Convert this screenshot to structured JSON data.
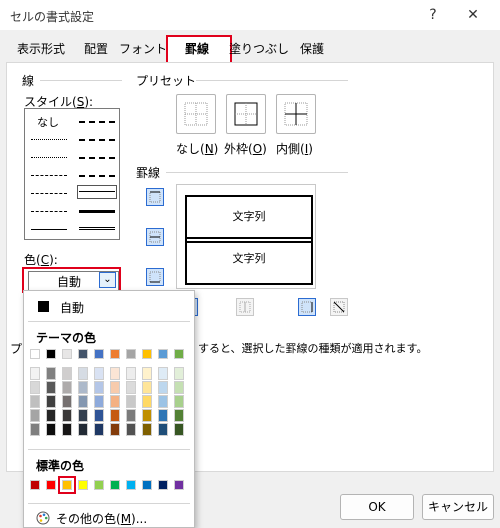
{
  "window": {
    "title": "セルの書式設定",
    "help_glyph": "?",
    "close_glyph": "✕"
  },
  "tabs": [
    {
      "label": "表示形式",
      "active": false
    },
    {
      "label": "配置",
      "active": false
    },
    {
      "label": "フォント",
      "active": false
    },
    {
      "label": "罫線",
      "active": true
    },
    {
      "label": "塗りつぶし",
      "active": false
    },
    {
      "label": "保護",
      "active": false
    }
  ],
  "line_group": {
    "title": "線",
    "style_label_pre": "スタイル(",
    "style_label_key": "S",
    "style_label_post": "):",
    "none_label": "なし",
    "color_label_pre": "色(",
    "color_label_key": "C",
    "color_label_post": "):",
    "color_value": "自動"
  },
  "preset_group": {
    "title": "プリセット",
    "none_pre": "なし(",
    "none_key": "N",
    "none_post": ")",
    "outline_pre": "外枠(",
    "outline_key": "O",
    "outline_post": ")",
    "inside_pre": "内側(",
    "inside_key": "I",
    "inside_post": ")"
  },
  "border_group": {
    "title": "罫線",
    "cell_text_1": "文字列",
    "cell_text_2": "文字列"
  },
  "hint_prefix": "プ",
  "hint_text": "すると、選択した罫線の種類が適用されます。",
  "color_popup": {
    "auto_label": "自動",
    "theme_title": "テーマの色",
    "standard_title": "標準の色",
    "more_pre": "その他の色(",
    "more_key": "M",
    "more_post": ")...",
    "theme_colors": [
      "#ffffff",
      "#000000",
      "#e7e6e6",
      "#44546a",
      "#4472c4",
      "#ed7d31",
      "#a5a5a5",
      "#ffc000",
      "#5b9bd5",
      "#70ad47"
    ],
    "theme_shades": [
      [
        "#f2f2f2",
        "#808080",
        "#d0cece",
        "#d6dce4",
        "#d9e2f3",
        "#fbe5d5",
        "#ededed",
        "#fff2cc",
        "#deebf6",
        "#e2efd9"
      ],
      [
        "#d8d8d8",
        "#595959",
        "#aeabab",
        "#adb9ca",
        "#b4c6e7",
        "#f7cbac",
        "#dbdbdb",
        "#ffe599",
        "#bdd7ee",
        "#c5e0b3"
      ],
      [
        "#bfbfbf",
        "#404040",
        "#757070",
        "#8497b0",
        "#8eaadb",
        "#f4b183",
        "#c9c9c9",
        "#ffd966",
        "#9cc3e5",
        "#a8d08d"
      ],
      [
        "#a5a5a5",
        "#262626",
        "#3a3838",
        "#333f4f",
        "#2f5496",
        "#c55a11",
        "#7b7b7b",
        "#bf8f00",
        "#2e75b5",
        "#538135"
      ],
      [
        "#7f7f7f",
        "#0d0d0d",
        "#171616",
        "#222a35",
        "#1f3864",
        "#833c0b",
        "#525252",
        "#7f6000",
        "#1f4e79",
        "#375623"
      ]
    ],
    "standard_colors": [
      "#c00000",
      "#ff0000",
      "#ffc000",
      "#ffff00",
      "#92d050",
      "#00b050",
      "#00b0f0",
      "#0070c0",
      "#002060",
      "#7030a0"
    ],
    "standard_selected_index": 2
  },
  "buttons": {
    "ok": "OK",
    "cancel": "キャンセル"
  },
  "colors": {
    "highlight": "#e0001b",
    "accent_blue": "#2b6bd1"
  }
}
